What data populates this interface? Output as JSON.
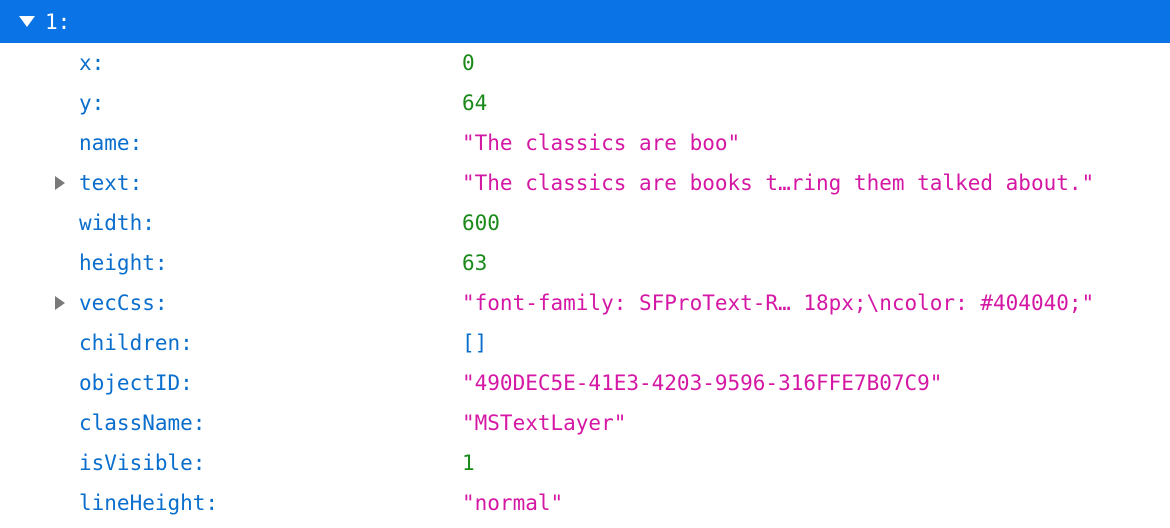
{
  "header": {
    "key": "1:",
    "expanded": true,
    "highlight_color": "#0a74e6"
  },
  "rows": [
    {
      "key": "x:",
      "value": "0",
      "type": "number",
      "expandable": false
    },
    {
      "key": "y:",
      "value": "64",
      "type": "number",
      "expandable": false
    },
    {
      "key": "name:",
      "value": "\"The classics are boo\"",
      "type": "string",
      "expandable": false
    },
    {
      "key": "text:",
      "value": "\"The classics are books t…ring them talked about.\"",
      "type": "string",
      "expandable": true
    },
    {
      "key": "width:",
      "value": "600",
      "type": "number",
      "expandable": false
    },
    {
      "key": "height:",
      "value": "63",
      "type": "number",
      "expandable": false
    },
    {
      "key": "vecCss:",
      "value": "\"font-family: SFProText-R… 18px;\\ncolor: #404040;\"",
      "type": "string",
      "expandable": true
    },
    {
      "key": "children:",
      "value": "[]",
      "type": "array",
      "expandable": false
    },
    {
      "key": "objectID:",
      "value": "\"490DEC5E-41E3-4203-9596-316FFE7B07C9\"",
      "type": "string",
      "expandable": false
    },
    {
      "key": "className:",
      "value": "\"MSTextLayer\"",
      "type": "string",
      "expandable": false
    },
    {
      "key": "isVisible:",
      "value": "1",
      "type": "number",
      "expandable": false
    },
    {
      "key": "lineHeight:",
      "value": "\"normal\"",
      "type": "string",
      "expandable": false
    }
  ],
  "colors": {
    "key": "#0a6ecd",
    "number": "#1a8a1a",
    "string": "#d417a4",
    "expander": "#7a7a7a"
  }
}
